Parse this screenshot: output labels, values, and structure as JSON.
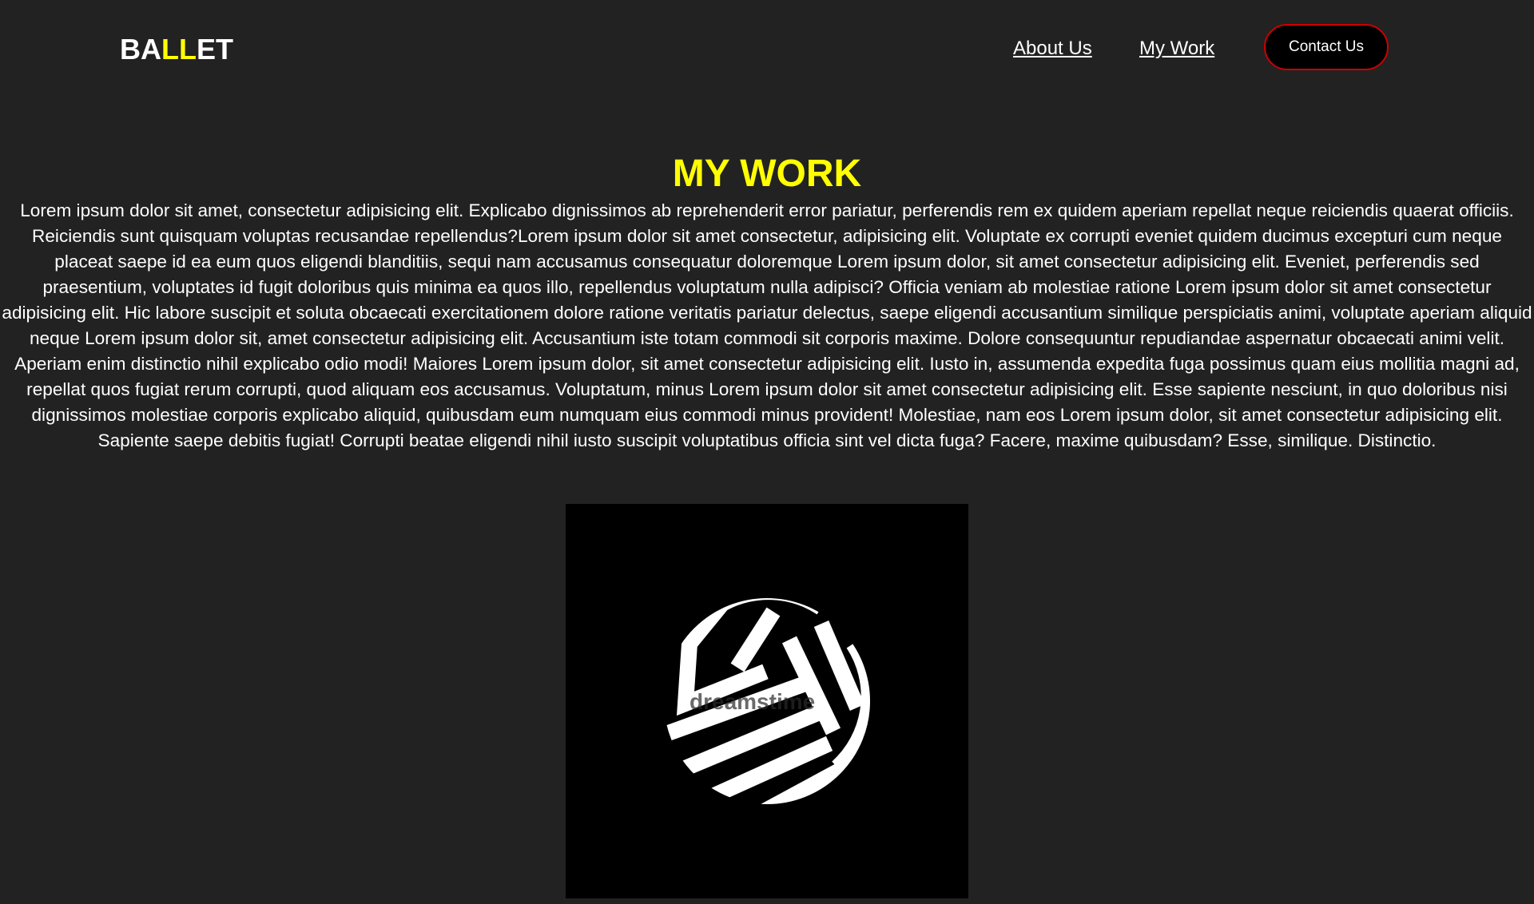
{
  "header": {
    "logo": {
      "part1": "BA",
      "part2": "LL",
      "part3": "ET"
    },
    "nav": {
      "about_label": "About Us",
      "work_label": "My Work",
      "contact_label": "Contact Us"
    }
  },
  "main": {
    "title": "MY WORK",
    "paragraph": "Lorem ipsum dolor sit amet, consectetur adipisicing elit. Explicabo dignissimos ab reprehenderit error pariatur, perferendis rem ex quidem aperiam repellat neque reiciendis quaerat officiis. Reiciendis sunt quisquam voluptas recusandae repellendus?Lorem ipsum dolor sit amet consectetur, adipisicing elit. Voluptate ex corrupti eveniet quidem ducimus excepturi cum neque placeat saepe id ea eum quos eligendi blanditiis, sequi nam accusamus consequatur doloremque Lorem ipsum dolor, sit amet consectetur adipisicing elit. Eveniet, perferendis sed praesentium, voluptates id fugit doloribus quis minima ea quos illo, repellendus voluptatum nulla adipisci? Officia veniam ab molestiae ratione Lorem ipsum dolor sit amet consectetur adipisicing elit. Hic labore suscipit et soluta obcaecati exercitationem dolore ratione veritatis pariatur delectus, saepe eligendi accusantium similique perspiciatis animi, voluptate aperiam aliquid neque Lorem ipsum dolor sit, amet consectetur adipisicing elit. Accusantium iste totam commodi sit corporis maxime. Dolore consequuntur repudiandae aspernatur obcaecati animi velit. Aperiam enim distinctio nihil explicabo odio modi! Maiores Lorem ipsum dolor, sit amet consectetur adipisicing elit. Iusto in, assumenda expedita fuga possimus quam eius mollitia magni ad, repellat quos fugiat rerum corrupti, quod aliquam eos accusamus. Voluptatum, minus Lorem ipsum dolor sit amet consectetur adipisicing elit. Esse sapiente nesciunt, in quo doloribus nisi dignissimos molestiae corporis explicabo aliquid, quibusdam eum numquam eius commodi minus provident! Molestiae, nam eos Lorem ipsum dolor, sit amet consectetur adipisicing elit. Sapiente saepe debitis fugiat! Corrupti beatae eligendi nihil iusto suscipit voluptatibus officia sint vel dicta fuga? Facere, maxime quibusdam? Esse, similique. Distinctio.",
    "image": {
      "icon": "sm-monogram-logo",
      "watermark": "dreamstime"
    }
  },
  "colors": {
    "background": "#222222",
    "accent": "#ffff00",
    "text": "#ffffff",
    "button_border": "#cc0000",
    "button_bg": "#000000"
  }
}
